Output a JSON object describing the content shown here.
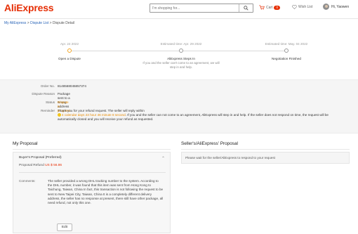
{
  "header": {
    "logo": "AliExpress",
    "search_placeholder": "I'm shopping for...",
    "cart_label": "Cart",
    "cart_count": "0",
    "wish_label": "Wish List",
    "user_greeting": "Hi, Yaowen"
  },
  "breadcrumb": {
    "items": [
      "My AliExpress",
      "Dispute List",
      "Dispute Detail"
    ],
    "separator": ">"
  },
  "steps": [
    {
      "date": "Apr. 24 2022",
      "name": "Open a Dispute",
      "active": true
    },
    {
      "date": "Estimated time:  Apr. 29 2022",
      "name": "AliExpress Steps In",
      "desc": "If you and the seller can't come to an agreement, we will step in and help.",
      "active": false
    },
    {
      "date": "Estimated time:  May. 04 2022",
      "name": "Negotiation Finished",
      "active": false
    }
  ],
  "info": {
    "order_label": "Order No.",
    "order_value": "8148568045857374",
    "reason_label": "Dispute Reason",
    "reason_value": "Package sent to a wrong address",
    "status_label": "Status",
    "status_value": "Dispute in progress",
    "reminder_label": "Reminder",
    "reminder_line1": "Thank you for your refund request. The seller will reply within",
    "reminder_countdown": "4 calendar days 23 hour 46 minute 8 second",
    "reminder_line2": ". If you and the seller can not come to an agreement, AliExpress will step in and help. If the seller does not respond on time, the request will be automatically closed and you will receive your refund as requested."
  },
  "my_proposal": {
    "title": "My Proposal",
    "buyer_heading": "Buyer's Proposal (Preferred)",
    "refund_label": "Proposal Refund",
    "refund_amount": "US $ 56.86",
    "comments_label": "Comments:",
    "comments_text": "The seller provided a wrong DHL tracking number to the system. According to the DHL number, it was found that this item was sent from Hong Kong to Taichung, Taiwan, China In fact, this transaction is not following the request to be sent to New Taipei City, Taiwan, China It is a completely different delivery address, the seller has no response at present, there still have other package, all need refund, not only this one.",
    "edit_label": "Edit"
  },
  "seller_proposal": {
    "title": "Seller's/AliExpress' Proposal",
    "message": "Please wait for the seller/AliExpress to respond to your request"
  },
  "colors": {
    "brand": "#e62e04",
    "status": "#e98b00",
    "link": "#2a65b8"
  }
}
